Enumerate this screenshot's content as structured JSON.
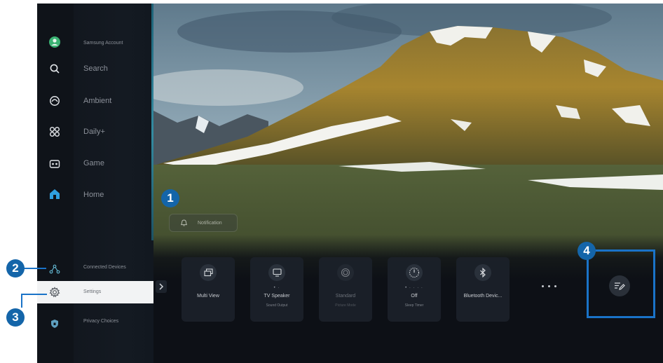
{
  "sidebar": {
    "items": [
      {
        "label": "Samsung Account",
        "icon": "account-avatar-icon"
      },
      {
        "label": "Search",
        "icon": "search-icon"
      },
      {
        "label": "Ambient",
        "icon": "ambient-icon"
      },
      {
        "label": "Daily+",
        "icon": "daily-plus-icon"
      },
      {
        "label": "Game",
        "icon": "game-icon"
      },
      {
        "label": "Home",
        "icon": "home-icon"
      }
    ],
    "bottom_items": [
      {
        "label": "Connected Devices",
        "icon": "connected-devices-icon"
      },
      {
        "label": "Settings",
        "icon": "settings-gear-icon"
      },
      {
        "label": "Privacy Choices",
        "icon": "privacy-shield-icon"
      }
    ]
  },
  "notification": {
    "label": "Notification",
    "icon": "bell-icon"
  },
  "quick_settings": [
    {
      "label": "Multi View",
      "sub": "",
      "dots": "",
      "icon": "multi-view-icon"
    },
    {
      "label": "TV Speaker",
      "sub": "Sound Output",
      "dots": "• ·",
      "icon": "tv-speaker-icon"
    },
    {
      "label": "Standard",
      "sub": "Picture Mode",
      "dots": "",
      "icon": "picture-mode-icon"
    },
    {
      "label": "Off",
      "sub": "Sleep Timer",
      "dots": "• · · · ·",
      "icon": "sleep-timer-icon"
    },
    {
      "label": "Bluetooth Devic...",
      "sub": "",
      "dots": "",
      "icon": "bluetooth-icon"
    }
  ],
  "callouts": [
    "1",
    "2",
    "3",
    "4"
  ],
  "colors": {
    "callout": "#1465a9",
    "highlight": "#1a73c8",
    "accent_edge": "#3aa0b8"
  }
}
